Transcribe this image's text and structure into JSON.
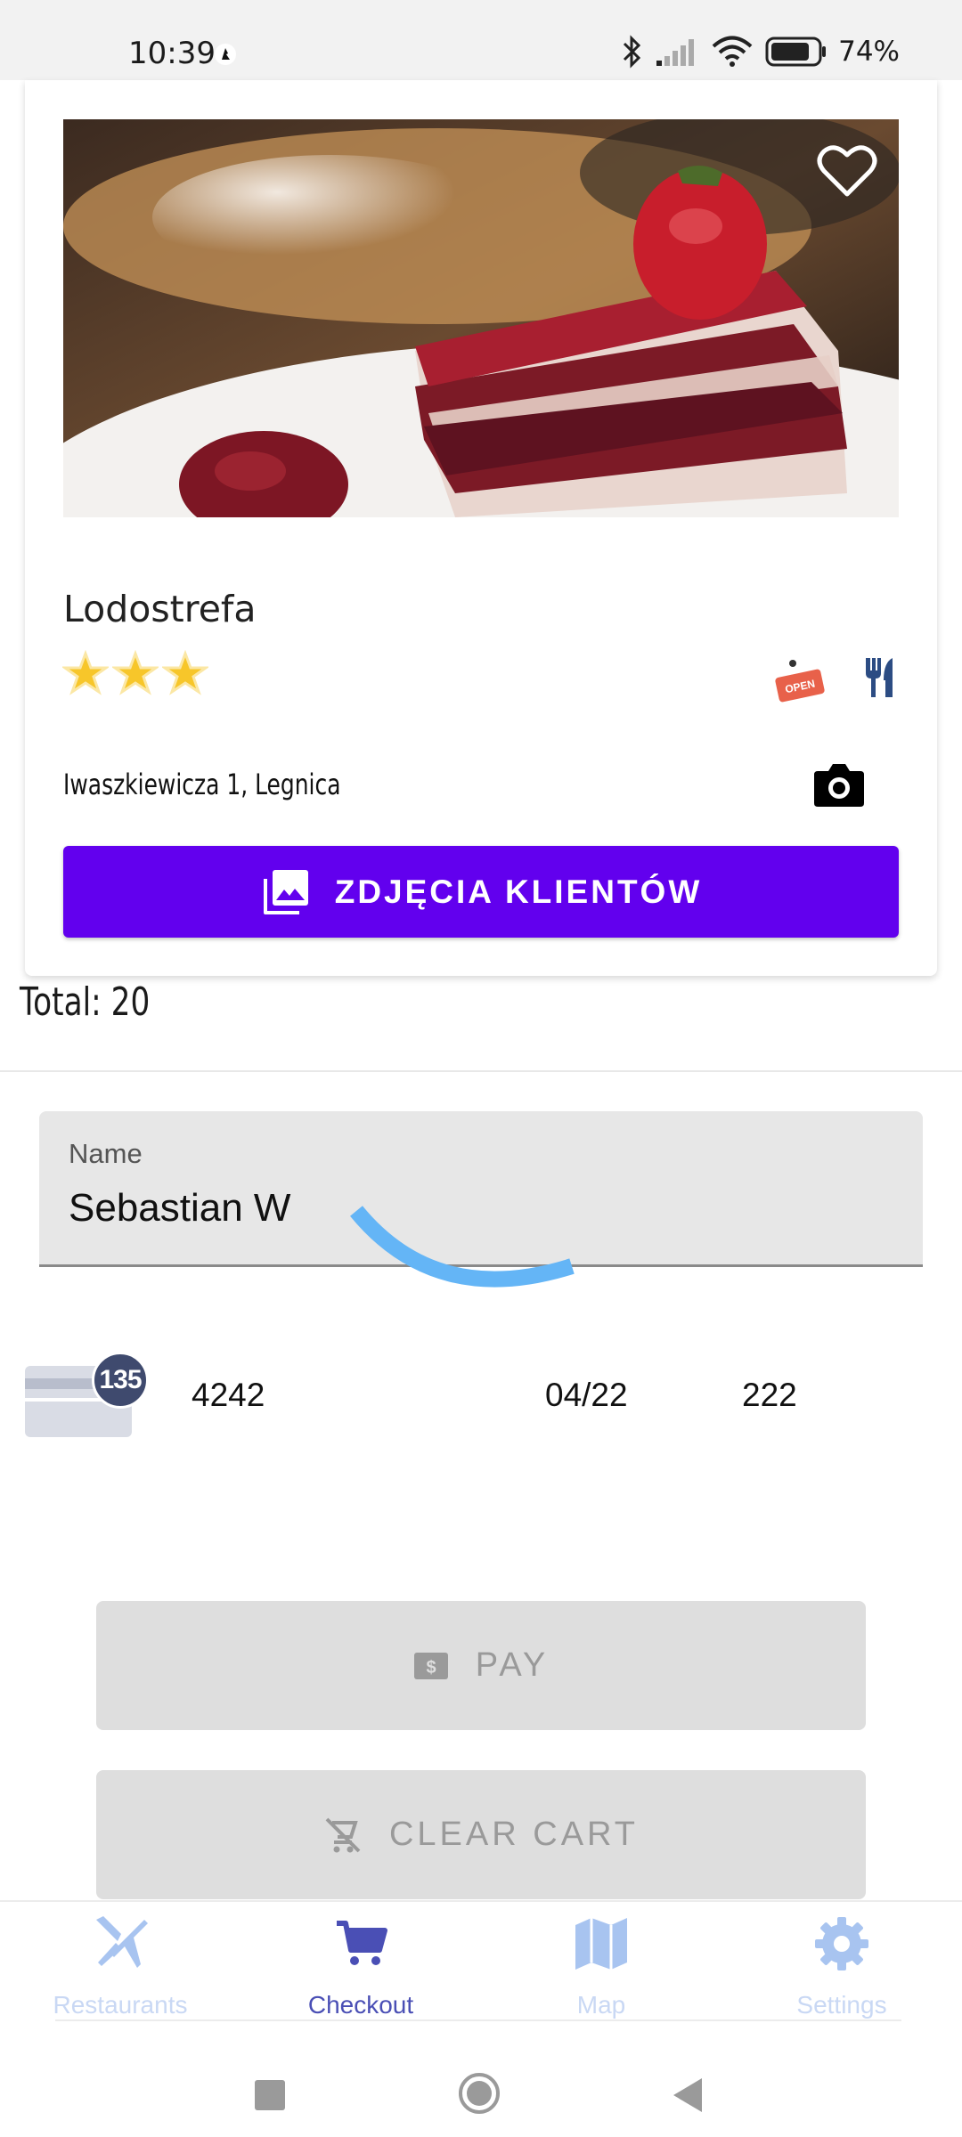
{
  "status_bar": {
    "time": "10:39",
    "battery": "74%"
  },
  "restaurant": {
    "name": "Lodostrefa",
    "rating_stars": 3,
    "open_badge": "OPEN",
    "address": "Iwaszkiewicza 1, Legnica",
    "photos_button_label": "ZDJĘCIA KLIENTÓW"
  },
  "checkout": {
    "total_label": "Total: 20",
    "name_label": "Name",
    "name_value": "Sebastian W",
    "card": {
      "badge": "135",
      "number": "4242",
      "expiry": "04/22",
      "cvc": "222"
    },
    "pay_label": "PAY",
    "clear_cart_label": "CLEAR CART"
  },
  "bottom_nav": {
    "items": [
      {
        "label": "Restaurants",
        "icon": "restaurants-icon",
        "active": false
      },
      {
        "label": "Checkout",
        "icon": "cart-icon",
        "active": true
      },
      {
        "label": "Map",
        "icon": "map-icon",
        "active": false
      },
      {
        "label": "Settings",
        "icon": "settings-icon",
        "active": false
      }
    ]
  },
  "colors": {
    "primary": "#6200ee",
    "nav_active": "#4a4fb5",
    "nav_inactive": "#c9d8f4",
    "spinner": "#64b5f6"
  }
}
